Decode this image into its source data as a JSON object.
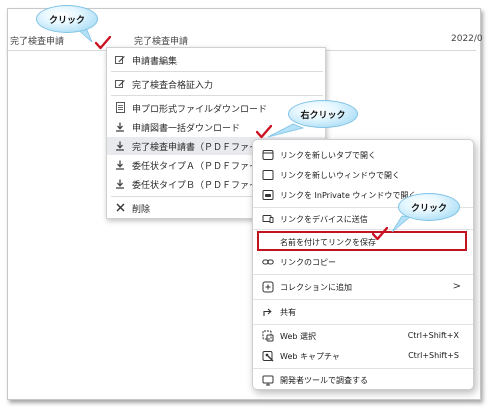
{
  "header": {
    "col1": "完了検査申請",
    "col2": "完了検査申請",
    "col3": "2022/0"
  },
  "menu1": {
    "items": [
      {
        "label": "申請書編集",
        "icon": "edit-icon"
      },
      {
        "label": "完了検査合格証入力",
        "icon": "edit-icon"
      },
      {
        "label": "申プロ形式ファイルダウンロード",
        "icon": "file-icon"
      },
      {
        "label": "申請図書一括ダウンロード",
        "icon": "download-icon"
      },
      {
        "label": "完了検査申請書（ＰＤＦファイ",
        "icon": "download-icon"
      },
      {
        "label": "委任状タイプＡ（ＰＤＦファイ",
        "icon": "download-icon"
      },
      {
        "label": "委任状タイプＢ（ＰＤＦファイ",
        "icon": "download-icon"
      },
      {
        "label": "削除",
        "icon": "close-icon"
      }
    ]
  },
  "context_menu": {
    "items": [
      {
        "label": "リンクを新しいタブで開く",
        "icon": "new-tab-icon"
      },
      {
        "label": "リンクを新しいウィンドウで開く",
        "icon": "new-window-icon"
      },
      {
        "label": "リンクを InPrivate ウィンドウで開く",
        "icon": "inprivate-icon"
      },
      {
        "label": "リンクをデバイスに送信",
        "icon": "send-device-icon"
      },
      {
        "label": "名前を付けてリンクを保存",
        "icon": ""
      },
      {
        "label": "リンクのコピー",
        "icon": "link-icon"
      },
      {
        "label": "コレクションに追加",
        "icon": "collection-icon",
        "submenu": ">"
      },
      {
        "label": "共有",
        "icon": "share-icon"
      },
      {
        "label": "Web 選択",
        "icon": "web-select-icon",
        "shortcut": "Ctrl+Shift+X"
      },
      {
        "label": "Web キャプチャ",
        "icon": "web-capture-icon",
        "shortcut": "Ctrl+Shift+S"
      },
      {
        "label": "開発者ツールで調査する",
        "icon": "devtools-icon"
      }
    ]
  },
  "callouts": {
    "click1": "クリック",
    "right_click": "右クリック",
    "click2": "クリック"
  },
  "colors": {
    "check": "#cc1122",
    "highlight_box": "#c0141e",
    "callout": "#b3e1f7"
  }
}
